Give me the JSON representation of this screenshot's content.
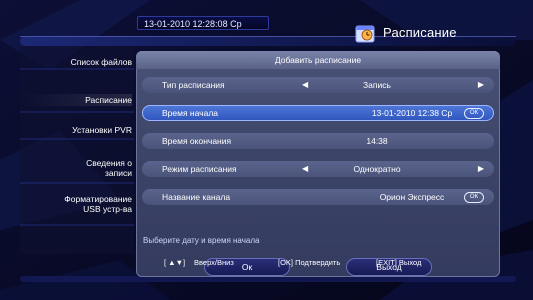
{
  "top": {
    "datetime": "13-01-2010 12:28:08 Ср",
    "title": "Расписание"
  },
  "sidebar": {
    "items": [
      {
        "label": "Список файлов"
      },
      {
        "label": "Расписание"
      },
      {
        "label": "Установки PVR"
      },
      {
        "label_line1": "Сведения о",
        "label_line2": "записи"
      },
      {
        "label_line1": "Форматирование",
        "label_line2": "USB устр-ва"
      }
    ]
  },
  "dialog": {
    "title": "Добавить расписание",
    "rows": [
      {
        "label": "Тип расписания",
        "value": "Запись"
      },
      {
        "label": "Время начала",
        "value": "13-01-2010 12:38 Ср",
        "ok": "ОК"
      },
      {
        "label": "Время окончания",
        "value": "14:38"
      },
      {
        "label": "Режим расписания",
        "value": "Однократно"
      },
      {
        "label": "Название канала",
        "value": "Орион Экспресс",
        "ok": "ОК"
      }
    ],
    "buttons": {
      "ok": "Ок",
      "exit": "Выход"
    },
    "hint": "Выберите дату и время начала",
    "footer": {
      "nav": "Вверх/Вниз",
      "confirm": "[OK] Подтвердить",
      "exit": "[EXIT] Выход"
    }
  },
  "colors": {
    "selected_row": "#2f55bd",
    "dialog_bg": "#3c4467",
    "background": "#0a0c2a"
  },
  "icons": [
    "calendar-clock-icon",
    "arrow-left-icon",
    "arrow-right-icon",
    "up-down-arrows-icon"
  ]
}
